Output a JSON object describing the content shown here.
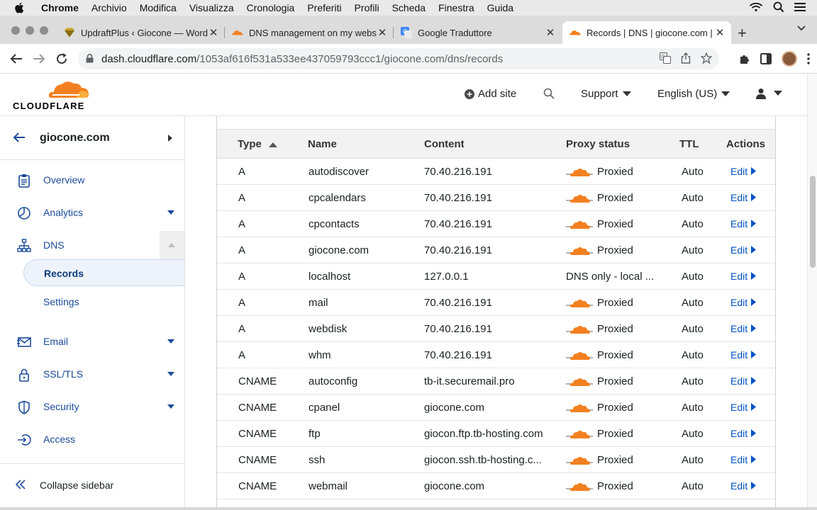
{
  "menubar": {
    "app": "Chrome",
    "items": [
      "Archivio",
      "Modifica",
      "Visualizza",
      "Cronologia",
      "Preferiti",
      "Profili",
      "Scheda",
      "Finestra",
      "Guida"
    ]
  },
  "tabs": [
    {
      "title": "UpdraftPlus ‹ Giocone — WordPress",
      "icon": "updraftplus-icon"
    },
    {
      "title": "DNS management on my website",
      "icon": "cloudflare-icon"
    },
    {
      "title": "Google Traduttore",
      "icon": "google-translate-icon"
    },
    {
      "title": "Records | DNS | giocone.com | Cloudflare",
      "icon": "cloudflare-icon"
    }
  ],
  "omnibox": {
    "host": "dash.cloudflare.com",
    "path": "/1053af616f531a533ee437059793ccc1/giocone.com/dns/records"
  },
  "header": {
    "logo": "CLOUDFLARE",
    "add_site": "Add site",
    "support": "Support",
    "language": "English (US)"
  },
  "sidebar": {
    "site": "giocone.com",
    "items": {
      "overview": "Overview",
      "analytics": "Analytics",
      "dns": "DNS",
      "records": "Records",
      "settings": "Settings",
      "email": "Email",
      "ssl": "SSL/TLS",
      "security": "Security",
      "access": "Access"
    },
    "collapse": "Collapse sidebar"
  },
  "table": {
    "columns": {
      "type": "Type",
      "name": "Name",
      "content": "Content",
      "proxy": "Proxy status",
      "ttl": "TTL",
      "actions": "Actions"
    },
    "edit_label": "Edit",
    "rows": [
      {
        "type": "A",
        "name": "autodiscover",
        "content": "70.40.216.191",
        "proxy": "Proxied",
        "proxied": true,
        "ttl": "Auto"
      },
      {
        "type": "A",
        "name": "cpcalendars",
        "content": "70.40.216.191",
        "proxy": "Proxied",
        "proxied": true,
        "ttl": "Auto"
      },
      {
        "type": "A",
        "name": "cpcontacts",
        "content": "70.40.216.191",
        "proxy": "Proxied",
        "proxied": true,
        "ttl": "Auto"
      },
      {
        "type": "A",
        "name": "giocone.com",
        "content": "70.40.216.191",
        "proxy": "Proxied",
        "proxied": true,
        "ttl": "Auto"
      },
      {
        "type": "A",
        "name": "localhost",
        "content": "127.0.0.1",
        "proxy": "DNS only - local ...",
        "proxied": false,
        "ttl": "Auto"
      },
      {
        "type": "A",
        "name": "mail",
        "content": "70.40.216.191",
        "proxy": "Proxied",
        "proxied": true,
        "ttl": "Auto"
      },
      {
        "type": "A",
        "name": "webdisk",
        "content": "70.40.216.191",
        "proxy": "Proxied",
        "proxied": true,
        "ttl": "Auto"
      },
      {
        "type": "A",
        "name": "whm",
        "content": "70.40.216.191",
        "proxy": "Proxied",
        "proxied": true,
        "ttl": "Auto"
      },
      {
        "type": "CNAME",
        "name": "autoconfig",
        "content": "tb-it.securemail.pro",
        "proxy": "Proxied",
        "proxied": true,
        "ttl": "Auto"
      },
      {
        "type": "CNAME",
        "name": "cpanel",
        "content": "giocone.com",
        "proxy": "Proxied",
        "proxied": true,
        "ttl": "Auto"
      },
      {
        "type": "CNAME",
        "name": "ftp",
        "content": "giocon.ftp.tb-hosting.com",
        "proxy": "Proxied",
        "proxied": true,
        "ttl": "Auto"
      },
      {
        "type": "CNAME",
        "name": "ssh",
        "content": "giocon.ssh.tb-hosting.c...",
        "proxy": "Proxied",
        "proxied": true,
        "ttl": "Auto"
      },
      {
        "type": "CNAME",
        "name": "webmail",
        "content": "giocone.com",
        "proxy": "Proxied",
        "proxied": true,
        "ttl": "Auto"
      }
    ]
  },
  "colors": {
    "accent_link": "#0051c3",
    "nav_text": "#1b4b9b",
    "cloud_orange": "#f38020"
  }
}
